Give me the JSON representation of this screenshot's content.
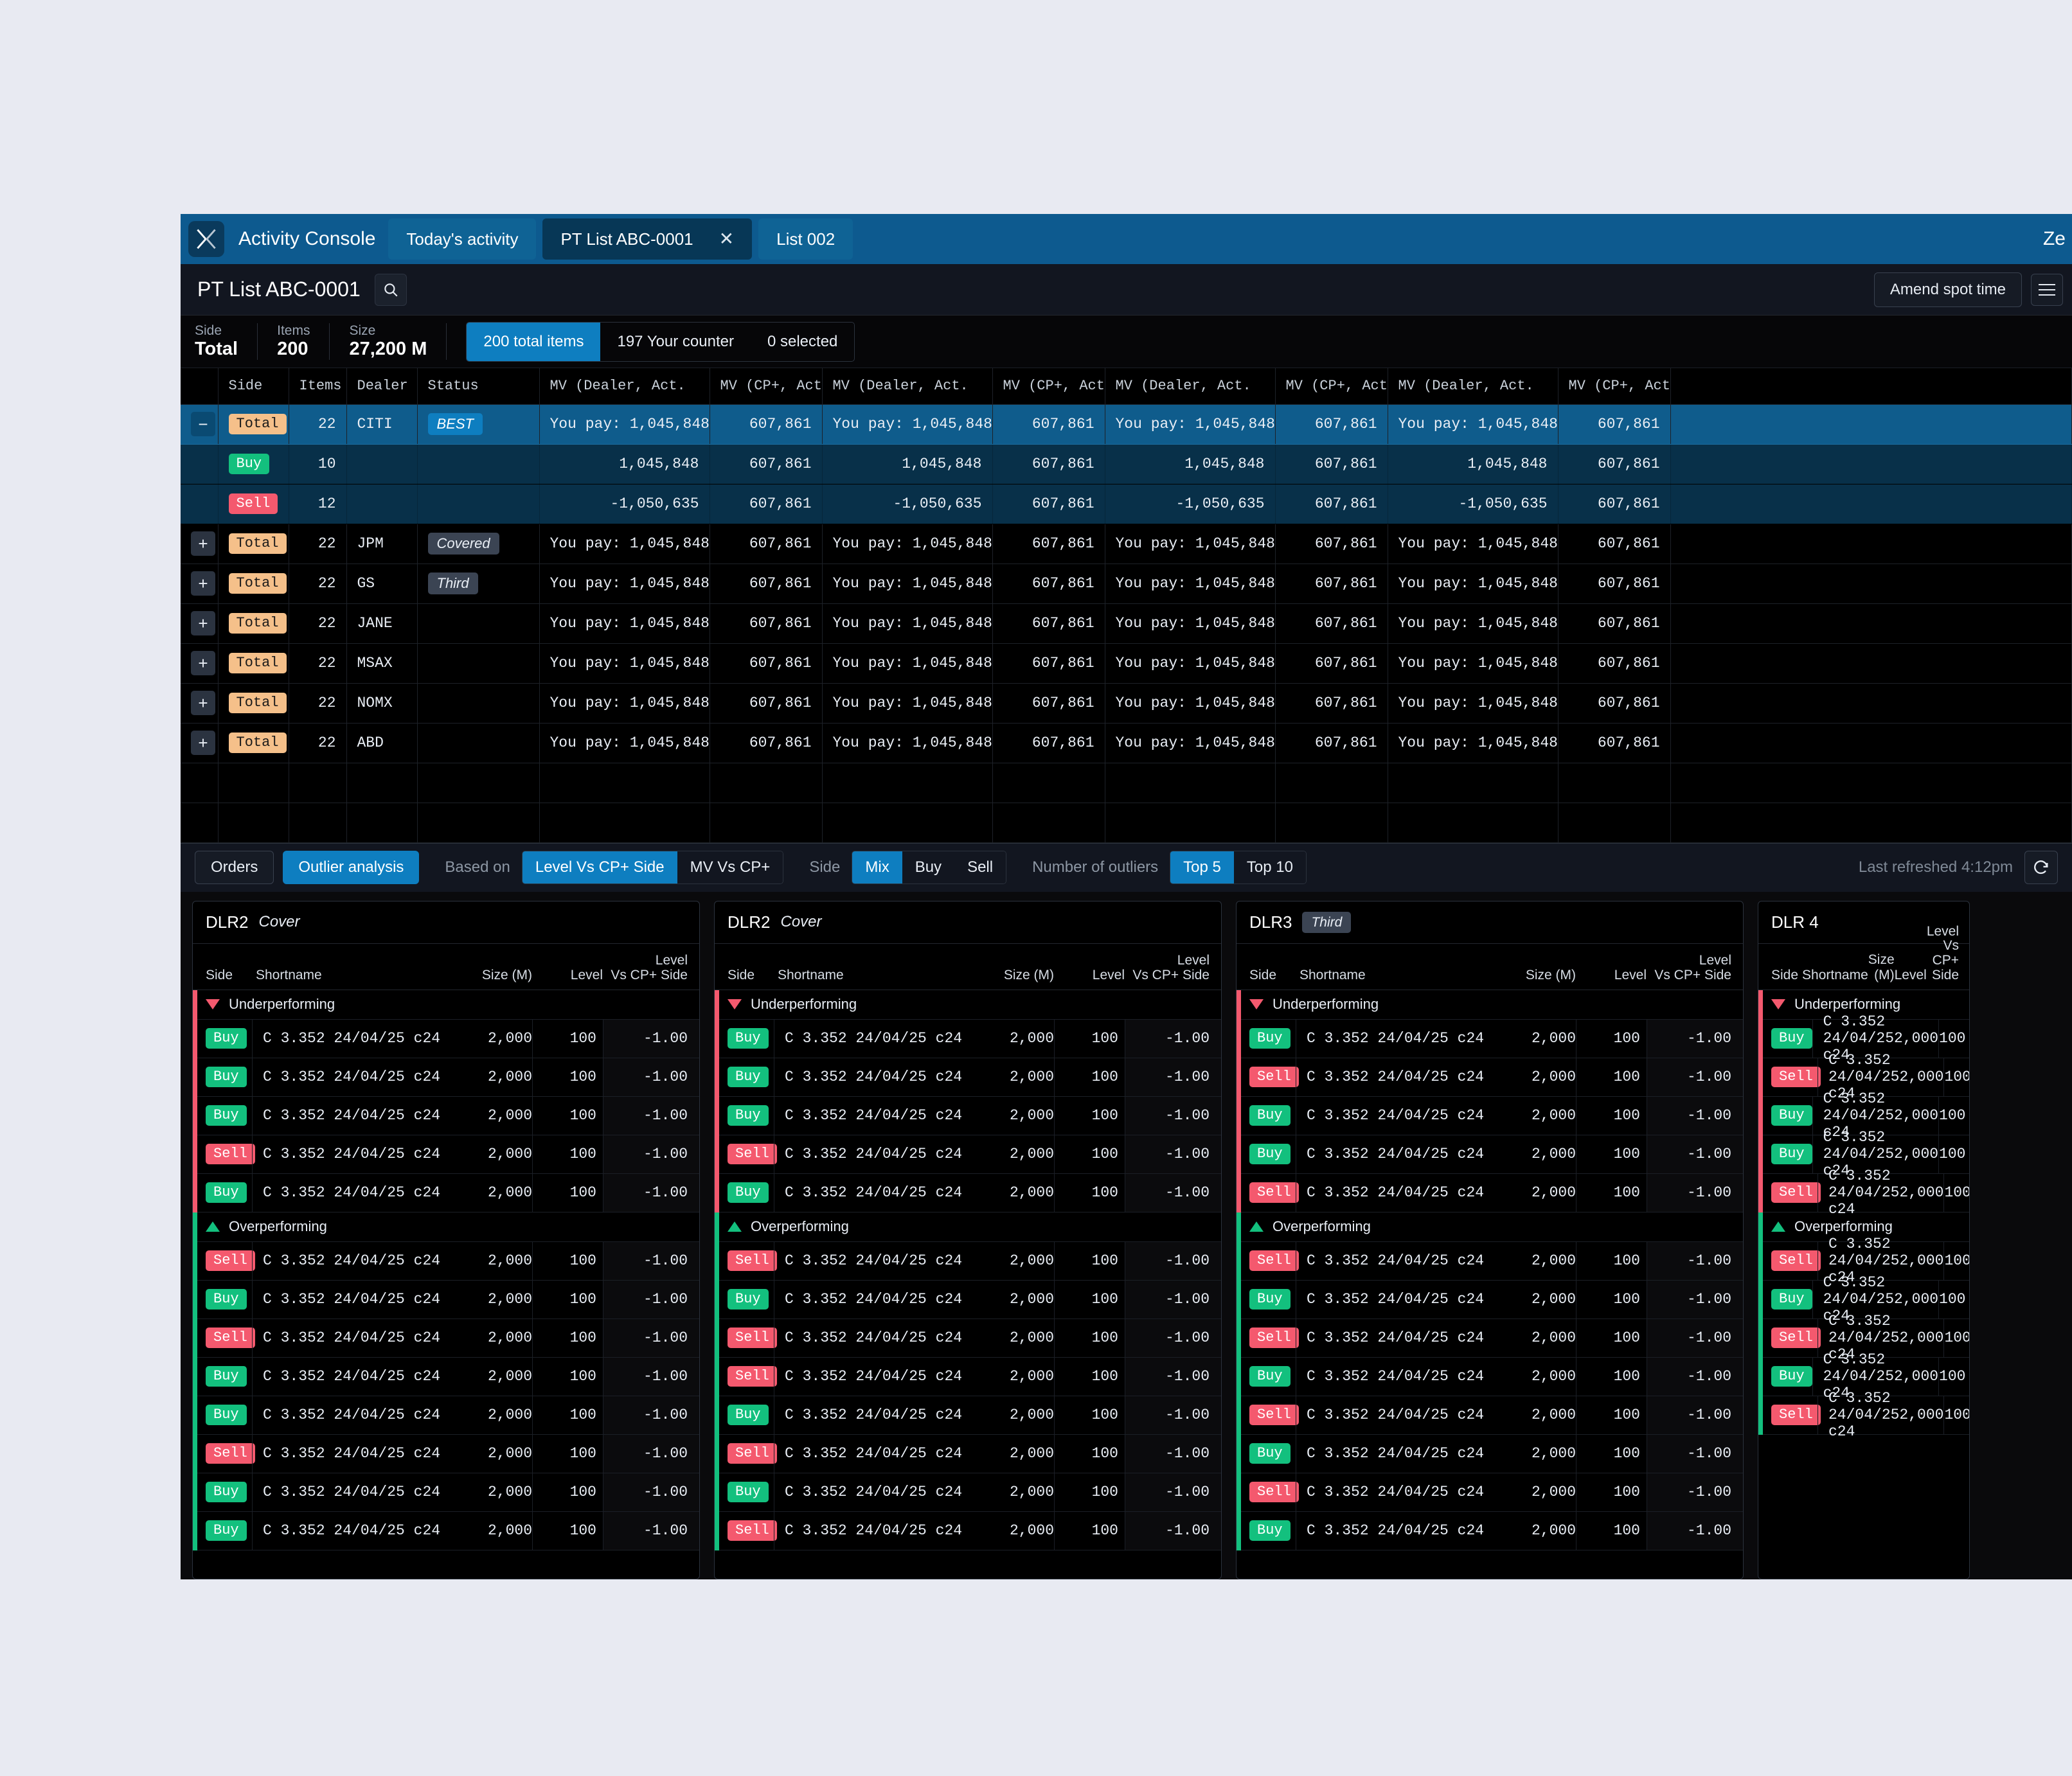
{
  "topbar": {
    "app_title": "Activity Console",
    "logo_icon": "x-logo-icon",
    "tabs": [
      {
        "label": "Today's activity",
        "selected": false,
        "closable": false
      },
      {
        "label": "PT List ABC-0001",
        "selected": true,
        "closable": true,
        "close_icon": "close-icon"
      },
      {
        "label": "List 002",
        "selected": false,
        "closable": false
      }
    ],
    "right_partial": "Ze"
  },
  "list_header": {
    "title": "PT List ABC-0001",
    "search_icon": "search-icon",
    "amend_spot_time": "Amend spot time",
    "menu_icon": "hamburger-menu-icon"
  },
  "summary": {
    "stats": [
      {
        "label": "Side",
        "value": "Total"
      },
      {
        "label": "Items",
        "value": "200"
      },
      {
        "label": "Size",
        "value": "27,200 M"
      }
    ],
    "filters": [
      {
        "label": "200 total items",
        "active": true
      },
      {
        "label": "197 Your counter",
        "active": false
      },
      {
        "label": "0 selected",
        "active": false
      }
    ]
  },
  "main_table": {
    "columns": [
      {
        "key": "expand",
        "label": "",
        "align": "left"
      },
      {
        "key": "side",
        "label": "Side",
        "align": "left"
      },
      {
        "key": "items",
        "label": "Items",
        "align": "right"
      },
      {
        "key": "dealer",
        "label": "Dealer",
        "align": "left"
      },
      {
        "key": "status",
        "label": "Status",
        "align": "left"
      },
      {
        "key": "mv_d1",
        "label": "MV (Dealer, Act.",
        "align": "left"
      },
      {
        "key": "mv_c1",
        "label": "MV (CP+, Act.)",
        "align": "right"
      },
      {
        "key": "mv_d2",
        "label": "MV (Dealer, Act.",
        "align": "left"
      },
      {
        "key": "mv_c2",
        "label": "MV (CP+, Act.)",
        "align": "right"
      },
      {
        "key": "mv_d3",
        "label": "MV (Dealer, Act.",
        "align": "left"
      },
      {
        "key": "mv_c3",
        "label": "MV (CP+, Act.)",
        "align": "right"
      },
      {
        "key": "mv_d4",
        "label": "MV (Dealer, Act.",
        "align": "left"
      },
      {
        "key": "mv_c4",
        "label": "MV (CP+, Act.)",
        "align": "right"
      },
      {
        "key": "pad",
        "label": "",
        "align": "left"
      }
    ],
    "rows": [
      {
        "state": "selected",
        "expand": "−",
        "side": "Total",
        "side_kind": "total",
        "items": "22",
        "dealer": "CITI",
        "status": "BEST",
        "status_kind": "best",
        "mv_d1": "You pay: 1,045,848",
        "mv_c1": "607,861",
        "mv_d2": "You pay: 1,045,848",
        "mv_c2": "607,861",
        "mv_d3": "You pay: 1,045,848",
        "mv_c3": "607,861",
        "mv_d4": "You pay: 1,045,848",
        "mv_c4": "607,861"
      },
      {
        "state": "sub",
        "expand": "",
        "side": "Buy",
        "side_kind": "buy",
        "items": "10",
        "dealer": "",
        "status": "",
        "status_kind": "",
        "mv_d1": "1,045,848",
        "mv_d1_color": "green",
        "mv_c1": "607,861",
        "mv_d2": "1,045,848",
        "mv_c2": "607,861",
        "mv_d3": "1,045,848",
        "mv_c3": "607,861",
        "mv_d4": "1,045,848",
        "mv_c4": "607,861"
      },
      {
        "state": "sub",
        "expand": "",
        "side": "Sell",
        "side_kind": "sell",
        "items": "12",
        "dealer": "",
        "status": "",
        "status_kind": "",
        "mv_d1": "-1,050,635",
        "mv_d1_color": "red",
        "mv_c1": "607,861",
        "mv_d2": "-1,050,635",
        "mv_c2": "607,861",
        "mv_d3": "-1,050,635",
        "mv_c3": "607,861",
        "mv_d4": "-1,050,635",
        "mv_c4": "607,861"
      },
      {
        "state": "normal",
        "expand": "+",
        "side": "Total",
        "side_kind": "total",
        "items": "22",
        "dealer": "JPM",
        "status": "Covered",
        "status_kind": "stat2",
        "mv_d1": "You pay: 1,045,848",
        "mv_c1": "607,861",
        "mv_d2": "You pay: 1,045,848",
        "mv_c2": "607,861",
        "mv_d3": "You pay: 1,045,848",
        "mv_c3": "607,861",
        "mv_d4": "You pay: 1,045,848",
        "mv_c4": "607,861"
      },
      {
        "state": "normal",
        "expand": "+",
        "side": "Total",
        "side_kind": "total",
        "items": "22",
        "dealer": "GS",
        "status": "Third",
        "status_kind": "stat2",
        "mv_d1": "You pay: 1,045,848",
        "mv_c1": "607,861",
        "mv_d2": "You pay: 1,045,848",
        "mv_c2": "607,861",
        "mv_d3": "You pay: 1,045,848",
        "mv_c3": "607,861",
        "mv_d4": "You pay: 1,045,848",
        "mv_c4": "607,861"
      },
      {
        "state": "normal",
        "expand": "+",
        "side": "Total",
        "side_kind": "total",
        "items": "22",
        "dealer": "JANE",
        "status": "",
        "status_kind": "",
        "mv_d1": "You pay: 1,045,848",
        "mv_c1": "607,861",
        "mv_d2": "You pay: 1,045,848",
        "mv_c2": "607,861",
        "mv_d3": "You pay: 1,045,848",
        "mv_c3": "607,861",
        "mv_d4": "You pay: 1,045,848",
        "mv_c4": "607,861"
      },
      {
        "state": "normal",
        "expand": "+",
        "side": "Total",
        "side_kind": "total",
        "items": "22",
        "dealer": "MSAX",
        "status": "",
        "status_kind": "",
        "mv_d1": "You pay: 1,045,848",
        "mv_c1": "607,861",
        "mv_d2": "You pay: 1,045,848",
        "mv_c2": "607,861",
        "mv_d3": "You pay: 1,045,848",
        "mv_c3": "607,861",
        "mv_d4": "You pay: 1,045,848",
        "mv_c4": "607,861"
      },
      {
        "state": "normal",
        "expand": "+",
        "side": "Total",
        "side_kind": "total",
        "items": "22",
        "dealer": "NOMX",
        "status": "",
        "status_kind": "",
        "mv_d1": "You pay: 1,045,848",
        "mv_c1": "607,861",
        "mv_d2": "You pay: 1,045,848",
        "mv_c2": "607,861",
        "mv_d3": "You pay: 1,045,848",
        "mv_c3": "607,861",
        "mv_d4": "You pay: 1,045,848",
        "mv_c4": "607,861"
      },
      {
        "state": "normal",
        "expand": "+",
        "side": "Total",
        "side_kind": "total",
        "items": "22",
        "dealer": "ABD",
        "status": "",
        "status_kind": "",
        "mv_d1": "You pay: 1,045,848",
        "mv_c1": "607,861",
        "mv_d2": "You pay: 1,045,848",
        "mv_c2": "607,861",
        "mv_d3": "You pay: 1,045,848",
        "mv_c3": "607,861",
        "mv_d4": "You pay: 1,045,848",
        "mv_c4": "607,861"
      }
    ],
    "empty_rows": 2
  },
  "toolbar": {
    "orders_label": "Orders",
    "outlier_label": "Outlier analysis",
    "based_on_label": "Based on",
    "based_on_options": [
      {
        "label": "Level Vs CP+ Side",
        "active": true
      },
      {
        "label": "MV Vs CP+",
        "active": false
      }
    ],
    "side_label": "Side",
    "side_options": [
      {
        "label": "Mix",
        "active": true
      },
      {
        "label": "Buy",
        "active": false
      },
      {
        "label": "Sell",
        "active": false
      }
    ],
    "outliers_label": "Number of outliers",
    "outliers_options": [
      {
        "label": "Top 5",
        "active": true
      },
      {
        "label": "Top 10",
        "active": false
      }
    ],
    "last_refreshed": "Last refreshed 4:12pm",
    "refresh_icon": "refresh-icon"
  },
  "cards_common": {
    "columns": [
      "Side",
      "Shortname",
      "Size (M)",
      "Level",
      "Level\nVs CP+ Side"
    ],
    "col_side": "Side",
    "col_shortname": "Shortname",
    "col_size": "Size (M)",
    "col_level": "Level",
    "col_vs_line1": "Level",
    "col_vs_line2": "Vs CP+ Side",
    "group_under": "Underperforming",
    "group_over": "Overperforming",
    "row_shortname": "C 3.352 24/04/25 c24",
    "row_size": "2,000",
    "row_level": "100",
    "row_vs": "-1.00"
  },
  "cards": [
    {
      "dealer": "DLR2",
      "status": "Cover",
      "status_kind": "italic",
      "under_sides": [
        "Buy",
        "Buy",
        "Buy",
        "Sell",
        "Buy"
      ],
      "over_sides": [
        "Sell",
        "Buy",
        "Sell",
        "Buy",
        "Buy",
        "Sell",
        "Buy",
        "Buy"
      ]
    },
    {
      "dealer": "DLR2",
      "status": "Cover",
      "status_kind": "italic",
      "under_sides": [
        "Buy",
        "Buy",
        "Buy",
        "Sell",
        "Buy"
      ],
      "over_sides": [
        "Sell",
        "Buy",
        "Sell",
        "Sell",
        "Buy",
        "Sell",
        "Buy",
        "Sell"
      ]
    },
    {
      "dealer": "DLR3",
      "status": "Third",
      "status_kind": "badge",
      "under_sides": [
        "Buy",
        "Sell",
        "Buy",
        "Buy",
        "Sell"
      ],
      "over_sides": [
        "Sell",
        "Buy",
        "Sell",
        "Buy",
        "Sell",
        "Buy",
        "Sell",
        "Buy"
      ]
    },
    {
      "dealer": "DLR 4",
      "status": "",
      "status_kind": "",
      "under_sides": [
        "Buy",
        "Sell",
        "Buy",
        "Buy",
        "Sell"
      ],
      "over_sides": [
        "Sell",
        "Buy",
        "Sell",
        "Buy",
        "Sell"
      ]
    }
  ],
  "colors": {
    "accent": "#0e7ec0",
    "buy": "#13c07e",
    "sell": "#f4596e",
    "total": "#f5c08a",
    "topbar": "#0d5a8f",
    "page_bg": "#e8eaf2"
  }
}
